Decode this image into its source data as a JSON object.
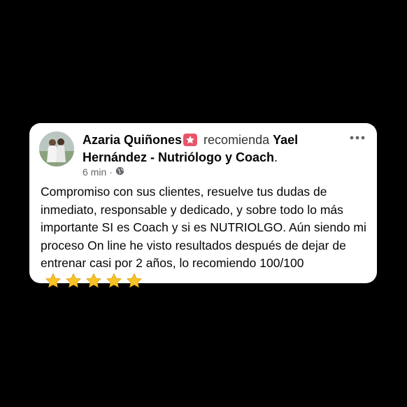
{
  "post": {
    "author": "Azaria Quiñones",
    "verb": "recomienda",
    "target": "Yael Hernández - Nutriólogo y Coach",
    "target_suffix": ".",
    "time": "6 min",
    "dot": "·",
    "visibility_icon": "globe-icon",
    "badge_icon": "star-badge-icon",
    "menu_icon": "more-options-icon",
    "text": "Compromiso con sus clientes, resuelve tus dudas de inmediato, responsable y dedicado, y sobre todo lo más importante SI es Coach y si es NUTRIOLGO. Aún siendo mi proceso On line he visto resultados después de dejar de entrenar casi por 2 años, lo recomiendo 100/100",
    "rating": 5,
    "star_icon": "star-emoji-icon"
  },
  "colors": {
    "background": "#000000",
    "card": "#ffffff",
    "badge": "#e9546b",
    "star": "#f7c325",
    "meta": "#65676b"
  }
}
